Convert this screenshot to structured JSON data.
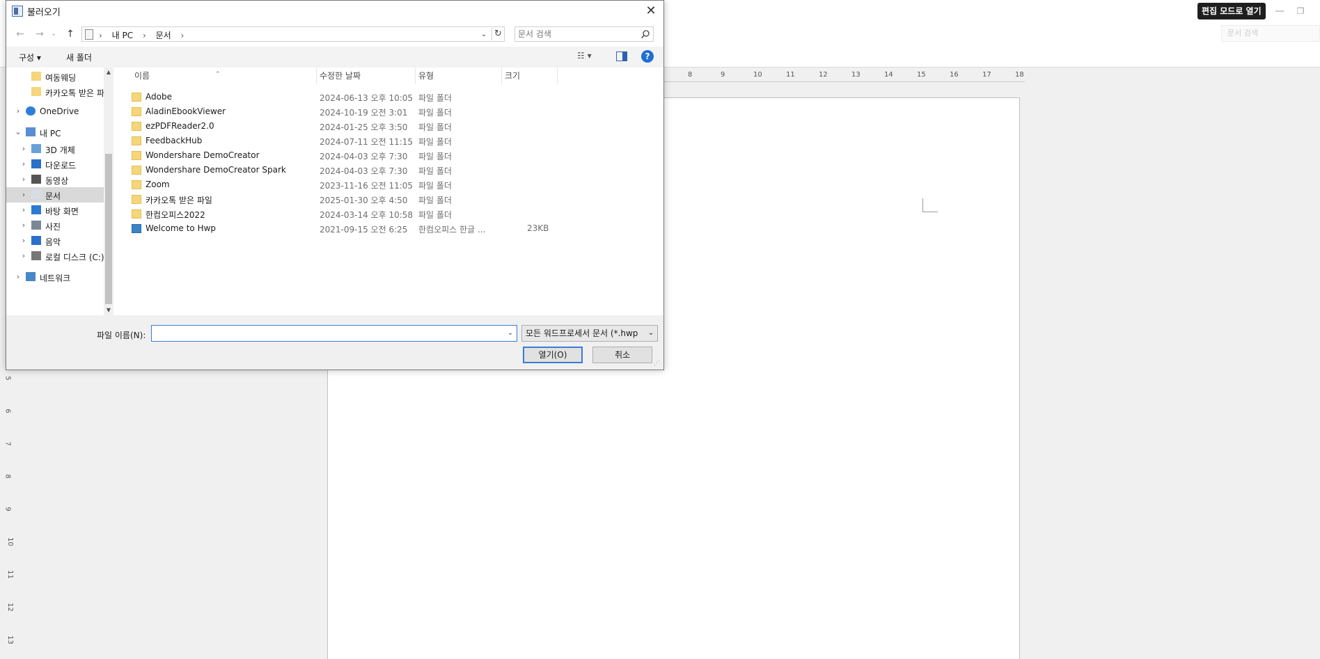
{
  "app": {
    "edit_mode_label": "편집 모드로 열기",
    "search_placeholder": "문서 검색",
    "ruler_h": [
      "8",
      "9",
      "10",
      "11",
      "12",
      "13",
      "14",
      "15",
      "16",
      "17",
      "18"
    ],
    "ruler_v": [
      "5",
      "6",
      "7",
      "8",
      "9",
      "10",
      "11",
      "12",
      "13"
    ]
  },
  "dialog": {
    "title": "불러오기",
    "close_glyph": "✕",
    "nav": {
      "back_glyph": "←",
      "forward_glyph": "→",
      "recent_glyph": "⌄",
      "up_glyph": "↑",
      "breadcrumb": [
        "내 PC",
        "문서"
      ],
      "separator": "›",
      "dropdown_glyph": "⌄",
      "refresh_glyph": "↻",
      "search_placeholder": "문서 검색"
    },
    "toolbar": {
      "organize": "구성 ▾",
      "new_folder": "새 폴더",
      "view_glyph": "☷ ▾",
      "help_glyph": "?"
    },
    "tree": [
      {
        "label": "여동웨딩",
        "icon": "folder-icon",
        "arrow": "",
        "level": 2
      },
      {
        "label": "카카오톡 받은 파",
        "icon": "folder-icon",
        "arrow": "",
        "level": 2
      },
      {
        "label": "OneDrive",
        "icon": "cloud-icon",
        "arrow": "›",
        "level": 1
      },
      {
        "label": "내 PC",
        "icon": "pc-icon",
        "arrow": "⌄",
        "level": 1
      },
      {
        "label": "3D 개체",
        "icon": "cube-icon",
        "arrow": "›",
        "level": 2
      },
      {
        "label": "다운로드",
        "icon": "download-icon",
        "arrow": "›",
        "level": 2
      },
      {
        "label": "동영상",
        "icon": "video-icon",
        "arrow": "›",
        "level": 2
      },
      {
        "label": "문서",
        "icon": "document-icon",
        "arrow": "›",
        "level": 2,
        "selected": true
      },
      {
        "label": "바탕 화면",
        "icon": "desktop-icon",
        "arrow": "›",
        "level": 2
      },
      {
        "label": "사진",
        "icon": "picture-icon",
        "arrow": "›",
        "level": 2
      },
      {
        "label": "음악",
        "icon": "music-icon",
        "arrow": "›",
        "level": 2
      },
      {
        "label": "로컬 디스크 (C:)",
        "icon": "disk-icon",
        "arrow": "›",
        "level": 2
      },
      {
        "label": "네트워크",
        "icon": "network-icon",
        "arrow": "›",
        "level": 1
      }
    ],
    "columns": {
      "name": "이름",
      "date": "수정한 날짜",
      "type": "유형",
      "size": "크기"
    },
    "files": [
      {
        "name": "Adobe",
        "date": "2024-06-13 오후 10:05",
        "type": "파일 폴더",
        "size": "",
        "icon": "folder-icon"
      },
      {
        "name": "AladinEbookViewer",
        "date": "2024-10-19 오전 3:01",
        "type": "파일 폴더",
        "size": "",
        "icon": "folder-icon"
      },
      {
        "name": "ezPDFReader2.0",
        "date": "2024-01-25 오후 3:50",
        "type": "파일 폴더",
        "size": "",
        "icon": "folder-icon"
      },
      {
        "name": "FeedbackHub",
        "date": "2024-07-11 오전 11:15",
        "type": "파일 폴더",
        "size": "",
        "icon": "folder-icon"
      },
      {
        "name": "Wondershare DemoCreator",
        "date": "2024-04-03 오후 7:30",
        "type": "파일 폴더",
        "size": "",
        "icon": "folder-icon"
      },
      {
        "name": "Wondershare DemoCreator Spark",
        "date": "2024-04-03 오후 7:30",
        "type": "파일 폴더",
        "size": "",
        "icon": "folder-icon"
      },
      {
        "name": "Zoom",
        "date": "2023-11-16 오전 11:05",
        "type": "파일 폴더",
        "size": "",
        "icon": "folder-icon"
      },
      {
        "name": "카카오톡 받은 파일",
        "date": "2025-01-30 오후 4:50",
        "type": "파일 폴더",
        "size": "",
        "icon": "folder-icon"
      },
      {
        "name": "한컴오피스2022",
        "date": "2024-03-14 오후 10:58",
        "type": "파일 폴더",
        "size": "",
        "icon": "folder-icon"
      },
      {
        "name": "Welcome to Hwp",
        "date": "2021-09-15 오전 6:25",
        "type": "한컴오피스 한글 ...",
        "size": "23KB",
        "icon": "hwp-file-icon"
      }
    ],
    "bottom": {
      "filename_label": "파일 이름(N):",
      "filename_value": "",
      "filter_value": "모든 워드프로세서 문서 (*.hwp",
      "open_label": "열기(O)",
      "cancel_label": "취소"
    }
  },
  "colors": {
    "accent": "#3c7bd6",
    "folder": "#f5d67a",
    "selected_row": "#d9d9d9"
  }
}
